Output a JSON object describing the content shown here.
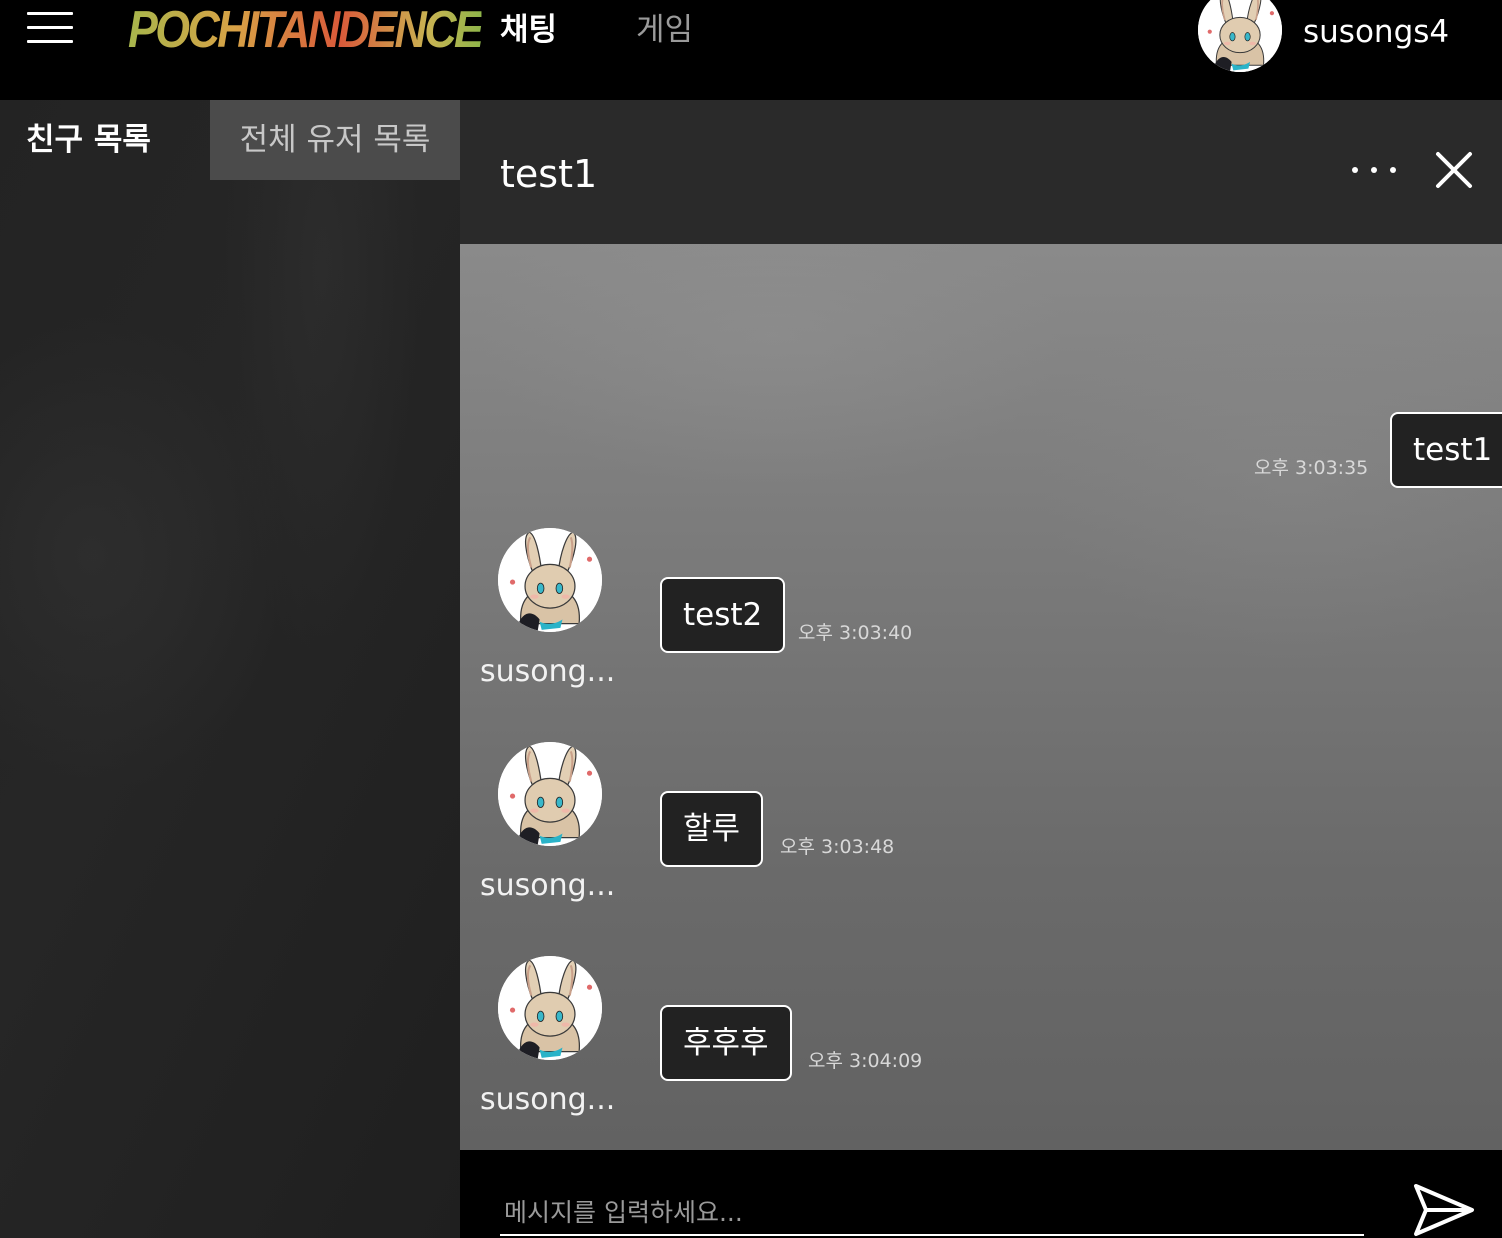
{
  "header": {
    "logo_text": "POCHITANDENCE",
    "nav": {
      "chat": "채팅",
      "game": "게임"
    },
    "user": {
      "name": "susongs4",
      "avatar_icon": "bunny-avatar"
    }
  },
  "sidebar": {
    "tabs": {
      "friends": "친구 목록",
      "all_users": "전체 유저 목록"
    },
    "active_tab": "friends"
  },
  "chat": {
    "title": "test1",
    "more_icon": "more-horizontal-icon",
    "close_icon": "close-icon",
    "messages": [
      {
        "side": "right",
        "text": "test1",
        "time": "오후 3:03:35"
      },
      {
        "side": "left",
        "sender": "susong...",
        "text": "test2",
        "time": "오후 3:03:40"
      },
      {
        "side": "left",
        "sender": "susong...",
        "text": "할루",
        "time": "오후 3:03:48"
      },
      {
        "side": "left",
        "sender": "susong...",
        "text": "후후후",
        "time": "오후 3:04:09"
      }
    ]
  },
  "composer": {
    "placeholder": "메시지를 입력하세요...",
    "value": "",
    "send_icon": "send-icon"
  },
  "colors": {
    "background": "#000000",
    "sidebar": "#242424",
    "chat_header": "#2a2a2a",
    "chat_body": "#767676",
    "bubble": "#222222",
    "inactive_tab": "#4b4b4b"
  }
}
